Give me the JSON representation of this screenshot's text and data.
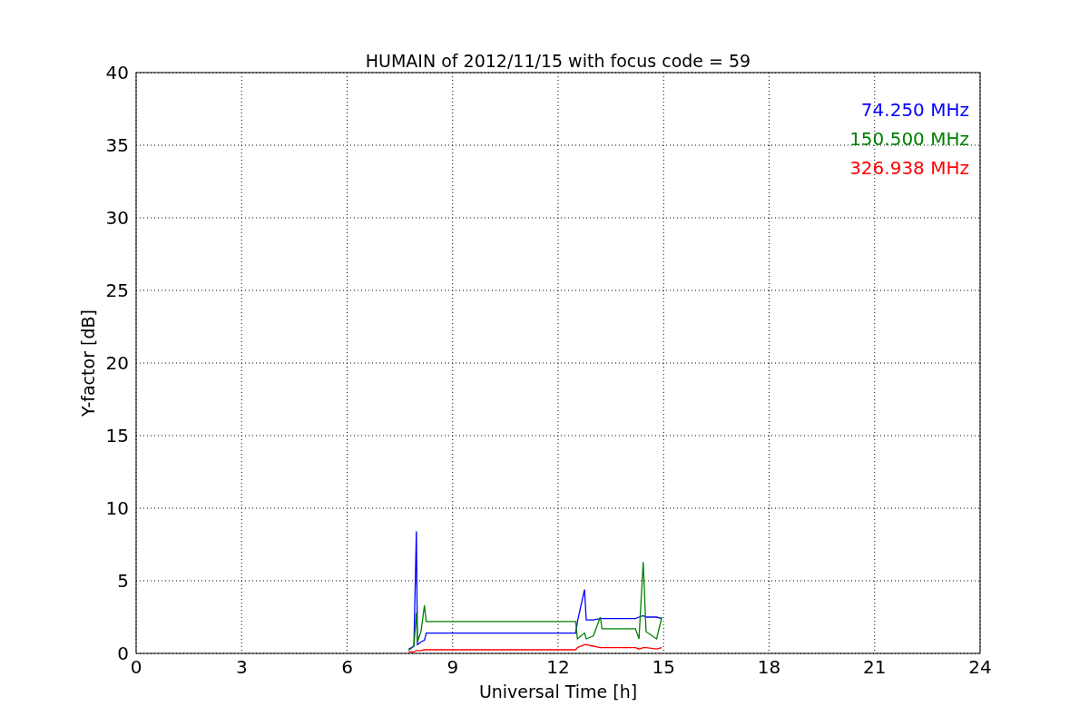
{
  "chart_data": {
    "type": "line",
    "title": "HUMAIN of 2012/11/15 with focus code = 59",
    "xlabel": "Universal Time [h]",
    "ylabel": "Y-factor [dB]",
    "xlim": [
      0,
      24
    ],
    "ylim": [
      0,
      40
    ],
    "xticks": [
      0,
      3,
      6,
      9,
      12,
      15,
      18,
      21,
      24
    ],
    "yticks": [
      0,
      5,
      10,
      15,
      20,
      25,
      30,
      35,
      40
    ],
    "grid": true,
    "x": [
      7.75,
      7.9,
      7.97,
      8.0,
      8.1,
      8.2,
      8.25,
      12.5,
      12.55,
      12.75,
      12.8,
      13.0,
      13.2,
      13.25,
      14.2,
      14.3,
      14.42,
      14.5,
      14.8,
      14.95
    ],
    "series": [
      {
        "name": "74.250 MHz",
        "color": "#0000ff",
        "values": [
          0.3,
          0.5,
          8.4,
          0.6,
          0.8,
          0.9,
          1.4,
          1.4,
          2.2,
          4.4,
          2.3,
          2.3,
          2.4,
          2.4,
          2.4,
          2.5,
          2.6,
          2.5,
          2.5,
          2.4
        ]
      },
      {
        "name": "150.500 MHz",
        "color": "#008000",
        "values": [
          0.2,
          0.5,
          2.8,
          0.8,
          1.5,
          3.3,
          2.2,
          2.2,
          1.0,
          1.4,
          1.0,
          1.2,
          2.5,
          1.7,
          1.7,
          1.0,
          6.3,
          1.5,
          1.0,
          2.5
        ]
      },
      {
        "name": "326.938 MHz",
        "color": "#ff0000",
        "values": [
          0.1,
          0.1,
          0.2,
          0.2,
          0.2,
          0.25,
          0.25,
          0.25,
          0.4,
          0.6,
          0.6,
          0.5,
          0.4,
          0.4,
          0.4,
          0.3,
          0.4,
          0.4,
          0.3,
          0.4
        ]
      }
    ]
  }
}
